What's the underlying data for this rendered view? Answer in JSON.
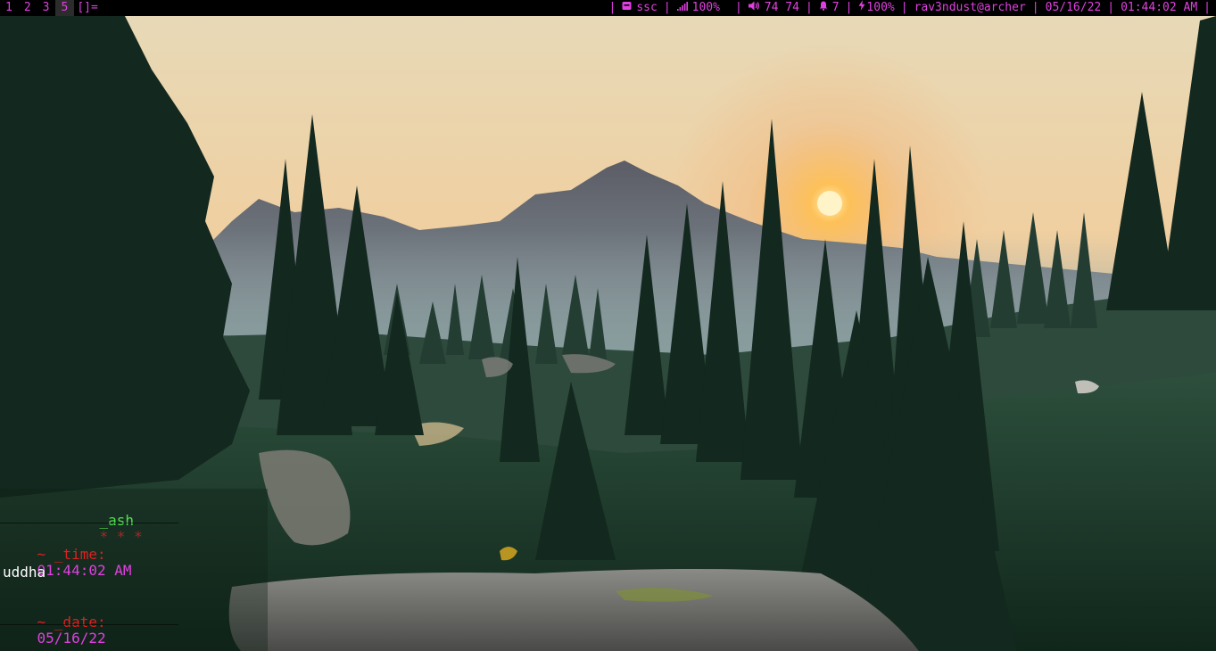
{
  "bar": {
    "workspaces": [
      {
        "label": "1",
        "active": false
      },
      {
        "label": "2",
        "active": false
      },
      {
        "label": "3",
        "active": false
      },
      {
        "label": "5",
        "active": true
      }
    ],
    "layout": "[]=",
    "status": {
      "sep": "|",
      "storage_label": "ssc",
      "signal_value": "100%",
      "volume_value": "74 74",
      "notifications_count": "7",
      "battery_value": "100%",
      "user_host": "rav3ndust@archer",
      "date": "05/16/22",
      "time": "01:44:02 AM"
    }
  },
  "terminal": {
    "header_name": "_ash",
    "header_stars": "* * *",
    "time_prefix": "~ _time:",
    "time_value": "01:44:02 AM",
    "partial_word": "uddha",
    "date_prefix": "~ _date:",
    "date_value": "05/16/22"
  },
  "colors": {
    "accent": "#e040e0",
    "green": "#52e052",
    "red": "#e02020",
    "bar_bg": "#000000"
  }
}
